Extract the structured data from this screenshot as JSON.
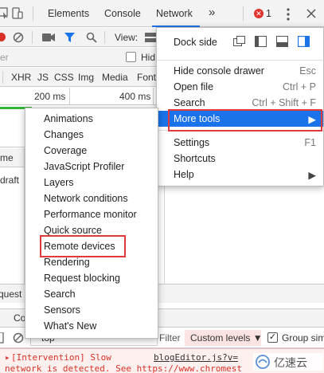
{
  "tabs": {
    "elements": "Elements",
    "console": "Console",
    "network": "Network",
    "more": "»",
    "error_count": "1"
  },
  "toolbar": {
    "view_label": "View:"
  },
  "filter": {
    "placeholder": "Filter",
    "shown_text": "er",
    "hide_label": "Hid"
  },
  "types": {
    "items": [
      "XHR",
      "JS",
      "CSS",
      "Img",
      "Media",
      "Font"
    ]
  },
  "timeline": {
    "tick1": "200 ms",
    "tick2": "400 ms"
  },
  "grid": {
    "name_header": "me",
    "row1": "draft"
  },
  "status": {
    "requests_text": "quest"
  },
  "drawer": {
    "tab_console": "Co",
    "context": "top",
    "filter": "Filter",
    "levels": "Custom levels ▼",
    "group_similar": "Group sim"
  },
  "console_message": {
    "line1": "[Intervention] Slow",
    "line2": "network is detected. See https://www.chromest",
    "source": "blogEditor.js?v="
  },
  "main_menu": {
    "dock_side": "Dock side",
    "items": [
      {
        "label": "Hide console drawer",
        "shortcut": "Esc"
      },
      {
        "label": "Open file",
        "shortcut": "Ctrl + P"
      },
      {
        "label": "Search",
        "shortcut": "Ctrl + Shift + F"
      },
      {
        "label": "More tools",
        "shortcut": "▶"
      },
      {
        "label": "Settings",
        "shortcut": "F1"
      },
      {
        "label": "Shortcuts",
        "shortcut": ""
      },
      {
        "label": "Help",
        "shortcut": "▶"
      }
    ]
  },
  "more_tools_menu": {
    "items": [
      "Animations",
      "Changes",
      "Coverage",
      "JavaScript Profiler",
      "Layers",
      "Network conditions",
      "Performance monitor",
      "Quick source",
      "Remote devices",
      "Rendering",
      "Request blocking",
      "Search",
      "Sensors",
      "What's New"
    ]
  },
  "watermark": "亿速云",
  "colors": {
    "highlight": "#1a73e8",
    "annotation_box": "#e03a3a",
    "error": "#e0342e"
  }
}
